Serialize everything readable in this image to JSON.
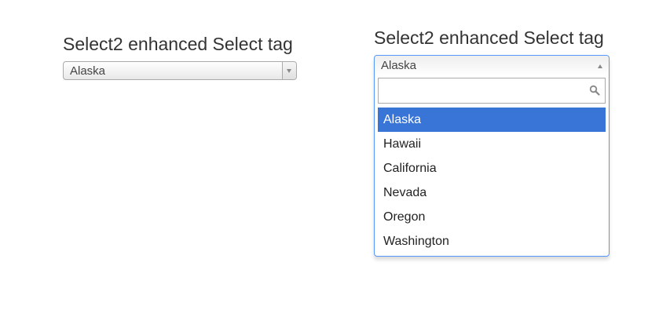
{
  "left_panel": {
    "title": "Select2 enhanced Select tag",
    "select": {
      "selected_value": "Alaska",
      "icon": "chevron-down-icon"
    }
  },
  "right_panel": {
    "title": "Select2 enhanced Select tag",
    "select": {
      "selected_value": "Alaska",
      "icon": "chevron-up-icon",
      "search": {
        "value": "",
        "placeholder": "",
        "icon": "search-icon"
      },
      "options": [
        {
          "label": "Alaska",
          "highlighted": true
        },
        {
          "label": "Hawaii",
          "highlighted": false
        },
        {
          "label": "California",
          "highlighted": false
        },
        {
          "label": "Nevada",
          "highlighted": false
        },
        {
          "label": "Oregon",
          "highlighted": false
        },
        {
          "label": "Washington",
          "highlighted": false
        }
      ]
    }
  },
  "colors": {
    "highlight": "#3875d7",
    "focus_border": "#5897fb",
    "border": "#aaaaaa",
    "text": "#333333"
  }
}
